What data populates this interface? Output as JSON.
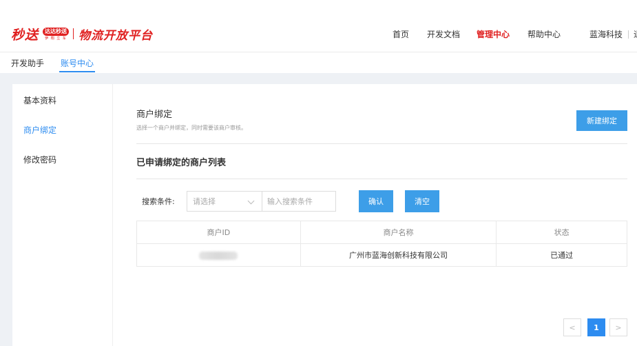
{
  "logo": {
    "brand": "秒送",
    "badge": "达达秒送",
    "badge_sub": "伊 翔 立 车",
    "platform": "物流开放平台"
  },
  "nav": {
    "items": [
      "首页",
      "开发文档",
      "管理中心",
      "帮助中心",
      "蓝海科技"
    ],
    "active_index": 2,
    "trailing": "退"
  },
  "tabs": [
    {
      "label": "开发助手"
    },
    {
      "label": "账号中心",
      "active": true
    }
  ],
  "sidebar": {
    "items": [
      {
        "label": "基本资料"
      },
      {
        "label": "商户绑定",
        "active": true
      },
      {
        "label": "修改密码"
      }
    ]
  },
  "section": {
    "title": "商户绑定",
    "description": "选择一个商户并绑定，同时需要该商户审核。",
    "new_button": "新建绑定"
  },
  "list": {
    "title": "已申请绑定的商户列表"
  },
  "search": {
    "label": "搜索条件:",
    "select_placeholder": "请选择",
    "input_placeholder": "输入搜索条件",
    "confirm": "确认",
    "clear": "清空"
  },
  "table": {
    "headers": [
      "商户ID",
      "商户名称",
      "状态"
    ],
    "rows": [
      {
        "merchant_id": "",
        "merchant_name": "广州市蓝海创新科技有限公司",
        "status": "已通过"
      }
    ]
  },
  "pagination": {
    "prev": "<",
    "current": "1",
    "next": ">"
  },
  "colors": {
    "brand_red": "#e02020",
    "primary_blue": "#3d9ee8",
    "success_green": "#19be6b"
  }
}
